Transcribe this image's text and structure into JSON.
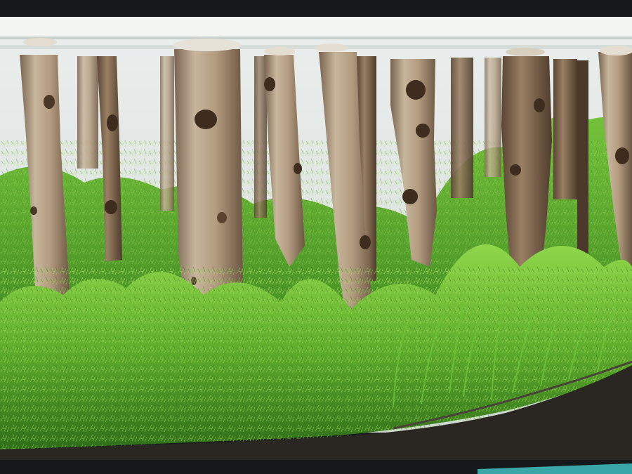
{
  "scene": {
    "subject": "aquascape-birch-forest",
    "colors": {
      "frame_dark": "#14181a",
      "background_water": "#dde3e1",
      "light_bar": "#f4f6f4",
      "bark_light": "#c9b9a2",
      "bark_mid": "#9c8469",
      "bark_dark": "#5d4a36",
      "plant_bright": "#7dcc3a",
      "plant_mid": "#4f9a24",
      "plant_dark": "#2c6a18",
      "substrate": "#2a2622",
      "teal_trim": "#3aa6a8"
    }
  }
}
